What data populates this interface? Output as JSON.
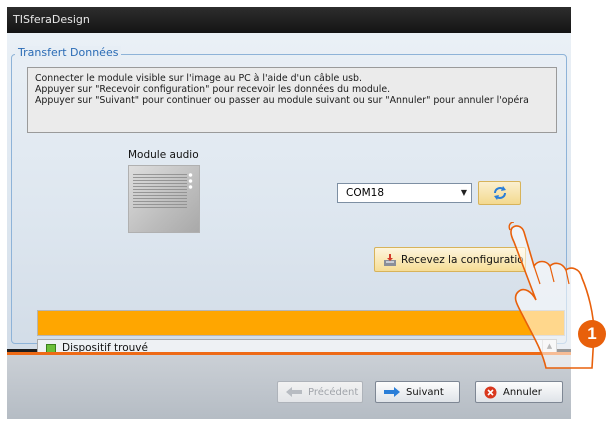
{
  "window": {
    "title": "TISferaDesign"
  },
  "group": {
    "legend": "Transfert Données"
  },
  "instructions": [
    "Connecter le module visible sur l'image au PC à l'aide d'un câble usb.",
    "Appuyer sur \"Recevoir configuration\" pour recevoir les données du module.",
    "Appuyer sur \"Suivant\" pour continuer ou passer au module suivant ou sur \"Annuler\" pour annuler l'opéra"
  ],
  "module": {
    "label": "Module audio"
  },
  "port_select": {
    "value": "COM18"
  },
  "receive_button": {
    "label": "Recevez la configuratio"
  },
  "progress": {
    "fraction": 1.0,
    "color": "#ffa600"
  },
  "status": {
    "items": [
      {
        "label": "Dispositif trouvé",
        "icon": "green-square-icon"
      }
    ]
  },
  "footer": {
    "previous_label": "Précédent",
    "next_label": "Suivant",
    "cancel_label": "Annuler"
  },
  "callout": {
    "number": "1",
    "color": "#e8600b"
  },
  "colors": {
    "accent": "#2a6bb5",
    "separator": "#ee6a16"
  }
}
